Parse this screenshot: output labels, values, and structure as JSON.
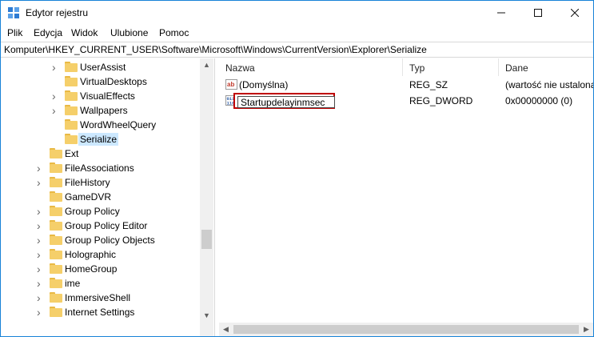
{
  "window": {
    "title": "Edytor rejestru"
  },
  "menu": [
    "Plik",
    "Edycja",
    "Widok",
    "Ulubione",
    "Pomoc"
  ],
  "address": "Komputer\\HKEY_CURRENT_USER\\Software\\Microsoft\\Windows\\CurrentVersion\\Explorer\\Serialize",
  "tree": [
    {
      "label": "UserAssist",
      "expandable": true,
      "depth": 2
    },
    {
      "label": "VirtualDesktops",
      "expandable": false,
      "depth": 2
    },
    {
      "label": "VisualEffects",
      "expandable": true,
      "depth": 2
    },
    {
      "label": "Wallpapers",
      "expandable": true,
      "depth": 2
    },
    {
      "label": "WordWheelQuery",
      "expandable": false,
      "depth": 2
    },
    {
      "label": "Serialize",
      "expandable": false,
      "depth": 2,
      "selected": true
    },
    {
      "label": "Ext",
      "expandable": false,
      "depth": 1
    },
    {
      "label": "FileAssociations",
      "expandable": true,
      "depth": 1
    },
    {
      "label": "FileHistory",
      "expandable": true,
      "depth": 1
    },
    {
      "label": "GameDVR",
      "expandable": false,
      "depth": 1
    },
    {
      "label": "Group Policy",
      "expandable": true,
      "depth": 1
    },
    {
      "label": "Group Policy Editor",
      "expandable": true,
      "depth": 1
    },
    {
      "label": "Group Policy Objects",
      "expandable": true,
      "depth": 1
    },
    {
      "label": "Holographic",
      "expandable": true,
      "depth": 1
    },
    {
      "label": "HomeGroup",
      "expandable": true,
      "depth": 1
    },
    {
      "label": "ime",
      "expandable": true,
      "depth": 1
    },
    {
      "label": "ImmersiveShell",
      "expandable": true,
      "depth": 1
    },
    {
      "label": "Internet Settings",
      "expandable": true,
      "depth": 1
    }
  ],
  "columns": {
    "name": "Nazwa",
    "type": "Typ",
    "data": "Dane"
  },
  "values": [
    {
      "name": "(Domyślna)",
      "type": "REG_SZ",
      "data": "(wartość nie ustalona)",
      "icon": "string-value-icon"
    },
    {
      "name": "Startupdelayinmsec",
      "type": "REG_DWORD",
      "data": "0x00000000 (0)",
      "icon": "dword-value-icon",
      "editing": true
    }
  ]
}
